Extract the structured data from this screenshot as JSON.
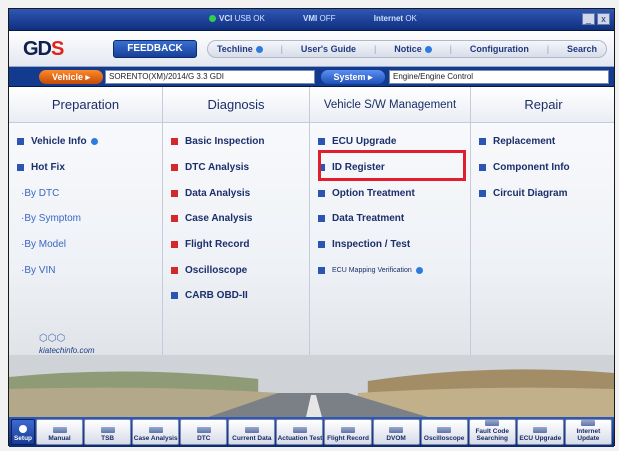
{
  "status_bar": {
    "items": [
      "VCI",
      "USB OK",
      "VMI",
      "OFF",
      "Internet",
      "OK"
    ]
  },
  "window_controls": [
    "_",
    "x"
  ],
  "header": {
    "logo": "GDS",
    "feedback_label": "FEEDBACK",
    "nav": [
      "Techline",
      "User's Guide",
      "Notice",
      "Configuration",
      "Search"
    ]
  },
  "vehicle_row": {
    "vehicle_label": "Vehicle",
    "vehicle_value": "SORENTO(XM)/2014/G 3.3 GDI",
    "system_label": "System",
    "system_value": "Engine/Engine Control"
  },
  "columns": [
    {
      "title": "Preparation",
      "items": [
        {
          "label": "Vehicle Info",
          "icon": "square-blue",
          "has_dot": true
        },
        {
          "label": "Hot Fix",
          "icon": "square-blue"
        },
        {
          "label": "·By DTC",
          "sub": true
        },
        {
          "label": "·By Symptom",
          "sub": true
        },
        {
          "label": "·By Model",
          "sub": true
        },
        {
          "label": "·By VIN",
          "sub": true
        }
      ]
    },
    {
      "title": "Diagnosis",
      "items": [
        {
          "label": "Basic Inspection",
          "icon": "square-red"
        },
        {
          "label": "DTC Analysis",
          "icon": "square-red"
        },
        {
          "label": "Data Analysis",
          "icon": "square-red"
        },
        {
          "label": "Case Analysis",
          "icon": "square-red"
        },
        {
          "label": "Flight Record",
          "icon": "square-red"
        },
        {
          "label": "Oscilloscope",
          "icon": "square-red"
        },
        {
          "label": "CARB OBD-II",
          "icon": "square-blue"
        }
      ]
    },
    {
      "title": "Vehicle S/W Management",
      "items": [
        {
          "label": "ECU Upgrade",
          "icon": "square-blue"
        },
        {
          "label": "ID Register",
          "icon": "square-blue",
          "highlighted": true
        },
        {
          "label": "Option Treatment",
          "icon": "square-blue"
        },
        {
          "label": "Data Treatment",
          "icon": "square-blue"
        },
        {
          "label": "Inspection / Test",
          "icon": "square-blue"
        },
        {
          "label": "ECU Mapping Verification",
          "icon": "square-blue",
          "has_dot": true
        }
      ]
    },
    {
      "title": "Repair",
      "items": [
        {
          "label": "Replacement",
          "icon": "square-blue"
        },
        {
          "label": "Component Info",
          "icon": "square-blue"
        },
        {
          "label": "Circuit Diagram",
          "icon": "square-blue"
        }
      ]
    }
  ],
  "kia_website": "kiatechinfo.com",
  "toolbar": [
    {
      "label": "Setup"
    },
    {
      "label": "Manual"
    },
    {
      "label": "TSB"
    },
    {
      "label": "Case Analysis"
    },
    {
      "label": "DTC"
    },
    {
      "label": "Current Data"
    },
    {
      "label": "Actuation Test"
    },
    {
      "label": "Flight Record"
    },
    {
      "label": "DVOM"
    },
    {
      "label": "Oscilloscope"
    },
    {
      "label": "Fault Code Searching"
    },
    {
      "label": "ECU Upgrade"
    },
    {
      "label": "Internet Update"
    }
  ],
  "colors": {
    "frame": "#0b2a6e",
    "highlight": "#e01e2e",
    "vehicle_label": "#e06214",
    "system_label": "#2f66d0"
  }
}
